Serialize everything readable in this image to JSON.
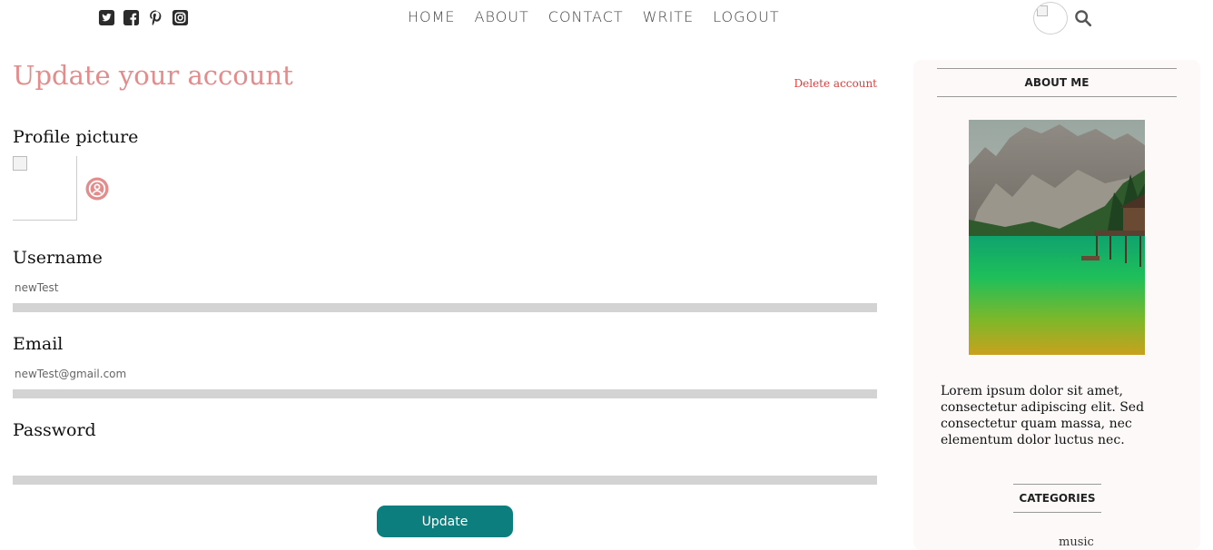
{
  "header": {
    "social": [
      {
        "name": "twitter-icon"
      },
      {
        "name": "facebook-icon"
      },
      {
        "name": "pinterest-icon"
      },
      {
        "name": "instagram-icon"
      }
    ],
    "nav": [
      "HOME",
      "ABOUT",
      "CONTACT",
      "WRITE",
      "LOGOUT"
    ]
  },
  "form": {
    "title": "Update your account",
    "delete_label": "Delete account",
    "profile_label": "Profile picture",
    "username_label": "Username",
    "username_placeholder": "newTest",
    "email_label": "Email",
    "email_placeholder": "newTest@gmail.com",
    "password_label": "Password",
    "password_placeholder": "",
    "update_label": "Update"
  },
  "sidebar": {
    "about_title": "ABOUT ME",
    "about_text": "Lorem ipsum dolor sit amet, consectetur adipiscing elit. Sed consectetur quam massa, nec elementum dolor luctus nec.",
    "categories_title": "CATEGORIES",
    "categories": [
      "music"
    ]
  },
  "colors": {
    "accent": "#e48c8c",
    "delete": "#e23c3c",
    "button": "#0c7e7e",
    "field_underline": "#d3d3d3"
  }
}
